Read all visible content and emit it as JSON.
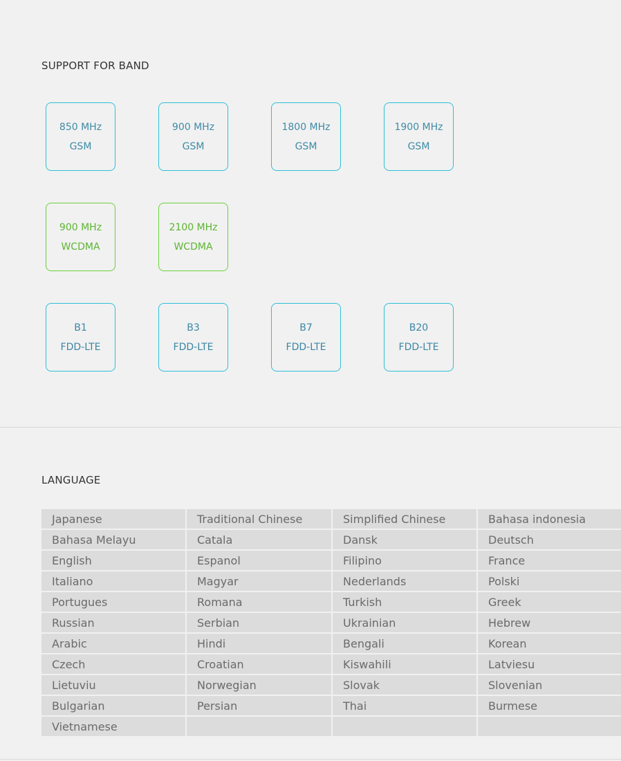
{
  "band_section": {
    "title": "SUPPORT FOR BAND",
    "gsm": [
      {
        "freq": "850 MHz",
        "type": "GSM"
      },
      {
        "freq": "900 MHz",
        "type": "GSM"
      },
      {
        "freq": "1800 MHz",
        "type": "GSM"
      },
      {
        "freq": "1900 MHz",
        "type": "GSM"
      }
    ],
    "wcdma": [
      {
        "freq": "900 MHz",
        "type": "WCDMA"
      },
      {
        "freq": "2100 MHz",
        "type": "WCDMA"
      }
    ],
    "lte": [
      {
        "freq": "B1",
        "type": "FDD-LTE"
      },
      {
        "freq": "B3",
        "type": "FDD-LTE"
      },
      {
        "freq": "B7",
        "type": "FDD-LTE"
      },
      {
        "freq": "B20",
        "type": "FDD-LTE"
      }
    ],
    "colors": {
      "gsm_border": "#2dbfd8",
      "wcdma_border": "#6bcf3c",
      "lte_border": "#2dbfd8"
    }
  },
  "language_section": {
    "title": "LANGUAGE",
    "rows": [
      [
        "Japanese",
        "Traditional Chinese",
        "Simplified Chinese",
        "Bahasa indonesia"
      ],
      [
        "Bahasa Melayu",
        "Catala",
        "Dansk",
        "Deutsch"
      ],
      [
        "English",
        "Espanol",
        "Filipino",
        "France"
      ],
      [
        "Italiano",
        "Magyar",
        "Nederlands",
        "Polski"
      ],
      [
        "Portugues",
        "Romana",
        "Turkish",
        "Greek"
      ],
      [
        "Russian",
        "Serbian",
        "Ukrainian",
        "Hebrew"
      ],
      [
        "Arabic",
        "Hindi",
        "Bengali",
        "Korean"
      ],
      [
        "Czech",
        "Croatian",
        "Kiswahili",
        "Latviesu"
      ],
      [
        "Lietuviu",
        "Norwegian",
        "Slovak",
        "Slovenian"
      ],
      [
        "Bulgarian",
        "Persian",
        "Thai",
        "Burmese"
      ],
      [
        "Vietnamese",
        "",
        "",
        ""
      ]
    ]
  }
}
